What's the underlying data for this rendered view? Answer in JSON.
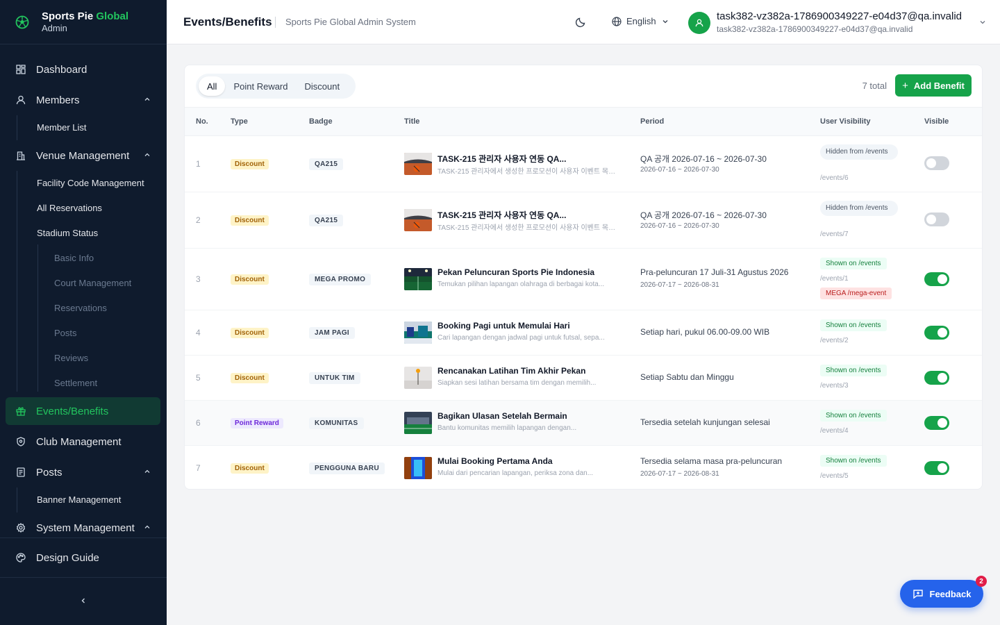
{
  "brand": {
    "title": "Sports Pie",
    "title_accent": "Global",
    "subtitle": "Admin",
    "accent_color": "#22c55e"
  },
  "sidebar": {
    "items": [
      {
        "label": "Dashboard",
        "icon": "dashboard-icon"
      },
      {
        "label": "Members",
        "icon": "user-icon",
        "expanded": true
      },
      {
        "label": "Member List"
      },
      {
        "label": "Venue Management",
        "icon": "building-icon",
        "expanded": true
      },
      {
        "label": "Facility Code Management"
      },
      {
        "label": "All Reservations"
      },
      {
        "label": "Stadium Status"
      },
      {
        "label": "Basic Info"
      },
      {
        "label": "Court Management"
      },
      {
        "label": "Reservations"
      },
      {
        "label": "Posts"
      },
      {
        "label": "Reviews"
      },
      {
        "label": "Settlement"
      },
      {
        "label": "Events/Benefits",
        "icon": "gift-icon",
        "active": true
      },
      {
        "label": "Club Management",
        "icon": "shield-icon"
      },
      {
        "label": "Posts",
        "icon": "document-icon",
        "expanded": true
      },
      {
        "label": "Banner Management"
      },
      {
        "label": "System Management",
        "icon": "gear-icon",
        "expanded": true
      },
      {
        "label": "Design Guide",
        "icon": "palette-icon"
      }
    ]
  },
  "header": {
    "title": "Events/Benefits",
    "subtitle": "Sports Pie Global Admin System",
    "language": "English",
    "user_name": "task382-vz382a-1786900349227-e04d37@qa.invalid",
    "user_email": "task382-vz382a-1786900349227-e04d37@qa.invalid"
  },
  "filters": {
    "tabs": [
      "All",
      "Point Reward",
      "Discount"
    ],
    "selected": "All"
  },
  "summary": {
    "total": "7 total",
    "add_label": "Add Benefit"
  },
  "table": {
    "columns": [
      "No.",
      "Type",
      "Badge",
      "Title",
      "Period",
      "User Visibility",
      "Visible"
    ],
    "rows": [
      {
        "no": "1",
        "type": "Discount",
        "badge": "QA215",
        "title": "TASK-215 관리자 사용자 연동 QA...",
        "desc": "TASK-215 관리자에서 생성한 프로모션이 사용자 이벤트 목록,...",
        "period": "QA 공개 2026-07-16 ~ 2026-07-30",
        "period_sub": "2026-07-16 ~ 2026-07-30",
        "visibility": "Hidden from /events",
        "path": "/events/6",
        "visible": false
      },
      {
        "no": "2",
        "type": "Discount",
        "badge": "QA215",
        "title": "TASK-215 관리자 사용자 연동 QA...",
        "desc": "TASK-215 관리자에서 생성한 프로모션이 사용자 이벤트 목록,...",
        "period": "QA 공개 2026-07-16 ~ 2026-07-30",
        "period_sub": "2026-07-16 ~ 2026-07-30",
        "visibility": "Hidden from /events",
        "path": "/events/7",
        "visible": false
      },
      {
        "no": "3",
        "type": "Discount",
        "badge": "MEGA PROMO",
        "title": "Pekan Peluncuran Sports Pie Indonesia",
        "desc": "Temukan pilihan lapangan olahraga di berbagai kota...",
        "period": "Pra-peluncuran 17 Juli-31 Agustus 2026",
        "period_sub": "2026-07-17 ~ 2026-08-31",
        "visibility": "Shown on /events",
        "path": "/events/1",
        "extra": "MEGA /mega-event",
        "visible": true
      },
      {
        "no": "4",
        "type": "Discount",
        "badge": "JAM PAGI",
        "title": "Booking Pagi untuk Memulai Hari",
        "desc": "Cari lapangan dengan jadwal pagi untuk futsal, sepa...",
        "period": "Setiap hari, pukul 06.00-09.00 WIB",
        "period_sub": "",
        "visibility": "Shown on /events",
        "path": "/events/2",
        "visible": true
      },
      {
        "no": "5",
        "type": "Discount",
        "badge": "UNTUK TIM",
        "title": "Rencanakan Latihan Tim Akhir Pekan",
        "desc": "Siapkan sesi latihan bersama tim dengan memilih...",
        "period": "Setiap Sabtu dan Minggu",
        "period_sub": "",
        "visibility": "Shown on /events",
        "path": "/events/3",
        "visible": true
      },
      {
        "no": "6",
        "type": "Point Reward",
        "badge": "KOMUNITAS",
        "title": "Bagikan Ulasan Setelah Bermain",
        "desc": "Bantu komunitas memilih lapangan dengan...",
        "period": "Tersedia setelah kunjungan selesai",
        "period_sub": "",
        "visibility": "Shown on /events",
        "path": "/events/4",
        "visible": true
      },
      {
        "no": "7",
        "type": "Discount",
        "badge": "PENGGUNA BARU",
        "title": "Mulai Booking Pertama Anda",
        "desc": "Mulai dari pencarian lapangan, periksa zona dan...",
        "period": "Tersedia selama masa pra-peluncuran",
        "period_sub": "2026-07-17 ~ 2026-08-31",
        "visibility": "Shown on /events",
        "path": "/events/5",
        "visible": true
      }
    ]
  },
  "feedback": {
    "label": "Feedback",
    "count": "2"
  },
  "colors": {
    "primary": "#16a34a",
    "sidebar_bg": "#0f1b2d",
    "feedback": "#2563eb",
    "badge_count": "#e11d48"
  }
}
